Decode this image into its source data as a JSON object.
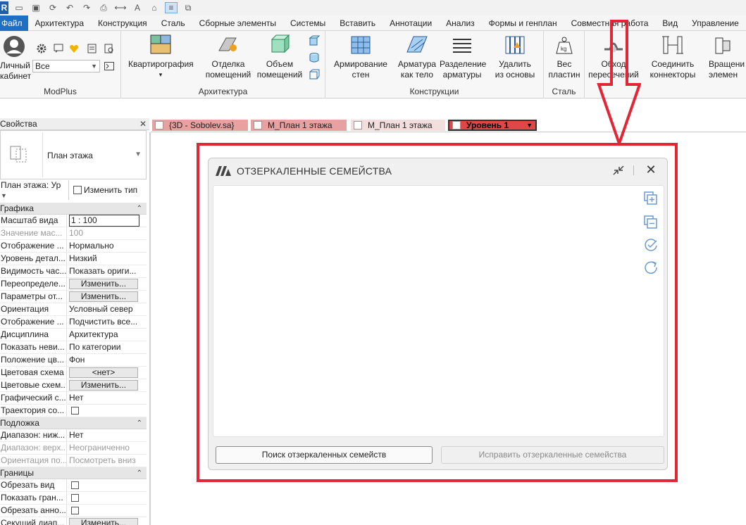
{
  "quick_access": {
    "app_logo": "R",
    "icons": [
      "open-icon",
      "save-icon",
      "sync-icon",
      "undo-icon",
      "redo-icon",
      "print-icon",
      "measure-icon",
      "text-icon",
      "home-icon",
      "thin-lines-icon",
      "switch-windows-icon"
    ]
  },
  "menubar": {
    "items": [
      "Файл",
      "Архитектура",
      "Конструкция",
      "Сталь",
      "Сборные элементы",
      "Системы",
      "Вставить",
      "Аннотации",
      "Анализ",
      "Формы и генплан",
      "Совместная работа",
      "Вид",
      "Управление"
    ]
  },
  "ribbon": {
    "modplus": {
      "title": "ModPlus",
      "cabinet_label_1": "Личный",
      "cabinet_label_2": "кабинет",
      "combo_value": "Все"
    },
    "architecture": {
      "title": "Архитектура",
      "buttons": [
        {
          "l1": "Квартирография",
          "l2": ""
        },
        {
          "l1": "Отделка",
          "l2": "помещений"
        },
        {
          "l1": "Объем",
          "l2": "помещений"
        }
      ]
    },
    "structure": {
      "title": "Конструкции",
      "buttons": [
        {
          "l1": "Армирование",
          "l2": "стен"
        },
        {
          "l1": "Арматура",
          "l2": "как тело"
        },
        {
          "l1": "Разделение",
          "l2": "арматуры"
        },
        {
          "l1": "Удалить",
          "l2": "из основы"
        }
      ]
    },
    "steel": {
      "title": "Сталь",
      "buttons": [
        {
          "l1": "Вес",
          "l2": "пластин"
        }
      ]
    },
    "other": {
      "buttons": [
        {
          "l1": "Обход",
          "l2": "пересечений"
        },
        {
          "l1": "Соединить",
          "l2": "коннекторы"
        },
        {
          "l1": "Вращени",
          "l2": "элемен"
        }
      ]
    }
  },
  "properties": {
    "header": "Свойства",
    "type_name": "План этажа",
    "view_selector": "План этажа: Ур",
    "edit_type": "Изменить тип",
    "sections": [
      {
        "name": "Графика",
        "rows": [
          {
            "k": "Масштаб вида",
            "v": "1 : 100",
            "kind": "input"
          },
          {
            "k": "Значение мас...",
            "v": "100",
            "kind": "dim"
          },
          {
            "k": "Отображение ...",
            "v": "Нормально"
          },
          {
            "k": "Уровень детал...",
            "v": "Низкий"
          },
          {
            "k": "Видимость час...",
            "v": "Показать ориги..."
          },
          {
            "k": "Переопределе...",
            "v": "Изменить...",
            "kind": "button"
          },
          {
            "k": "Параметры от...",
            "v": "Изменить...",
            "kind": "button"
          },
          {
            "k": "Ориентация",
            "v": "Условный север"
          },
          {
            "k": "Отображение ...",
            "v": "Подчистить все..."
          },
          {
            "k": "Дисциплина",
            "v": "Архитектура"
          },
          {
            "k": "Показать неви...",
            "v": "По категории"
          },
          {
            "k": "Положение цв...",
            "v": "Фон"
          },
          {
            "k": "Цветовая схема",
            "v": "<нет>",
            "kind": "button"
          },
          {
            "k": "Цветовые схем...",
            "v": "Изменить...",
            "kind": "button"
          },
          {
            "k": "Графический с...",
            "v": "Нет"
          },
          {
            "k": "Траектория со...",
            "v": "",
            "kind": "checkbox"
          }
        ]
      },
      {
        "name": "Подложка",
        "rows": [
          {
            "k": "Диапазон: ниж...",
            "v": "Нет"
          },
          {
            "k": "Диапазон: верх...",
            "v": "Неограниченно",
            "kind": "dim"
          },
          {
            "k": "Ориентация по...",
            "v": "Посмотреть вниз",
            "kind": "dim"
          }
        ]
      },
      {
        "name": "Границы",
        "rows": [
          {
            "k": "Обрезать вид",
            "v": "",
            "kind": "checkbox"
          },
          {
            "k": "Показать гран...",
            "v": "",
            "kind": "checkbox"
          },
          {
            "k": "Обрезать анно...",
            "v": "",
            "kind": "checkbox"
          },
          {
            "k": "Секущий диап...",
            "v": "Изменить...",
            "kind": "button"
          }
        ]
      }
    ]
  },
  "tabs": [
    {
      "label": "{3D - Sobolev.sa}"
    },
    {
      "label": "М_План 1 этажа"
    },
    {
      "label": "М_План 1 этажа"
    },
    {
      "label": "Уровень 1"
    }
  ],
  "dialog": {
    "title": "ОТЗЕРКАЛЕННЫЕ СЕМЕЙСТВА",
    "find_button": "Поиск отзеркаленных семейств",
    "fix_button": "Исправить отзеркаленные семейства",
    "side_icons": [
      "select-all-add-icon",
      "select-remove-icon",
      "check-all-icon",
      "refresh-icon"
    ]
  },
  "colors": {
    "accent": "#1f6fc5",
    "highlight_red": "#e32636",
    "active_tab": "#e04848"
  }
}
